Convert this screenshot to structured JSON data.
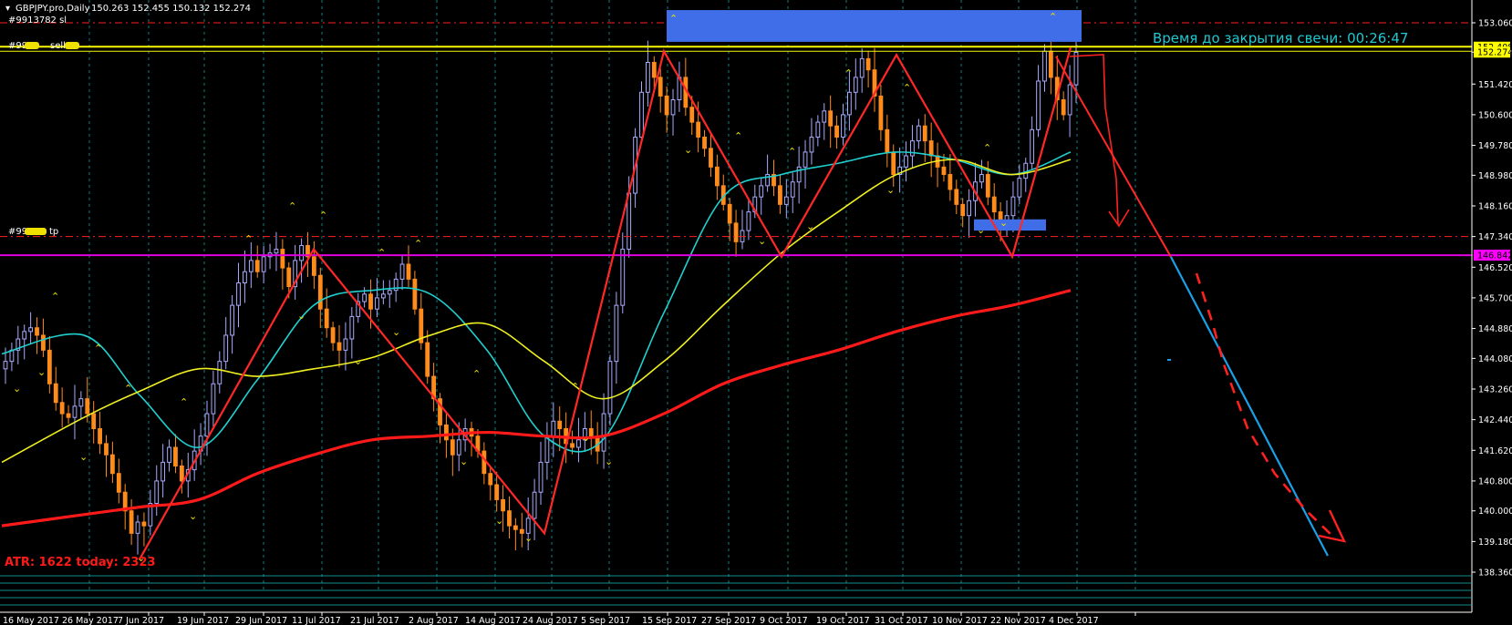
{
  "header": {
    "symbol": "GBPJPY.pro,Daily",
    "ohlc": "150.263 152.455 150.132 152.274",
    "order_sl": "#9913782 sl",
    "order_sell": "#99",
    "order_sell_suffix": "sell",
    "order_tp": "#99",
    "order_tp_suffix": "tp"
  },
  "timer_label": "Время до закрытия свечи: 00:26:47",
  "atr_label": "ATR: 1622  today: 2323",
  "colors": {
    "background": "#000000",
    "bull_candle": "#aaaaff",
    "bear_candle": "#ff8c1a",
    "ma_fast": "#20d0d0",
    "ma_mid": "#f0f020",
    "ma_slow": "#ff1a1a",
    "zigzag": "#ff2828",
    "resistance": "#f8f800",
    "support": "#e000e0",
    "zone": "#3f6ee8",
    "projection": "#1aa0e8",
    "grid": "#1ab0b0"
  },
  "chart_data": {
    "type": "candlestick",
    "title": "GBPJPY.pro,Daily",
    "y_ticks": [
      "153.060",
      "152.274",
      "151.420",
      "150.600",
      "149.780",
      "148.980",
      "148.160",
      "147.340",
      "146.520",
      "145.700",
      "144.880",
      "144.080",
      "143.260",
      "142.440",
      "141.620",
      "140.800",
      "140.000",
      "139.180",
      "138.360"
    ],
    "price_labels": [
      {
        "text": "152.408",
        "value": 152.408,
        "color": "#ffff00"
      },
      {
        "text": "152.274",
        "value": 152.274,
        "color": "#ffff00"
      },
      {
        "text": "146.842",
        "value": 146.842,
        "color": "#ff00ff"
      }
    ],
    "x_ticks": [
      "16 May 2017",
      "26 May 2017",
      "7 Jun 2017",
      "19 Jun 2017",
      "29 Jun 2017",
      "11 Jul 2017",
      "21 Jul 2017",
      "2 Aug 2017",
      "14 Aug 2017",
      "24 Aug 2017",
      "5 Sep 2017",
      "15 Sep 2017",
      "27 Sep 2017",
      "9 Oct 2017",
      "19 Oct 2017",
      "31 Oct 2017",
      "10 Nov 2017",
      "22 Nov 2017",
      "4 Dec 2017"
    ],
    "ylim": [
      138.1,
      153.4
    ],
    "levels": {
      "resistance": 152.42,
      "stop_loss_dashed": 153.06,
      "support": 146.84,
      "take_profit_dashed": 147.34
    },
    "close_series": [
      144.0,
      144.3,
      144.6,
      144.8,
      144.9,
      144.7,
      144.3,
      143.4,
      142.9,
      142.6,
      142.5,
      142.8,
      143.0,
      142.6,
      142.2,
      141.8,
      141.5,
      141.0,
      140.5,
      140.0,
      139.4,
      139.7,
      139.6,
      140.2,
      140.8,
      141.3,
      141.7,
      141.2,
      140.8,
      141.1,
      141.6,
      142.0,
      142.6,
      143.4,
      144.0,
      144.7,
      145.5,
      146.1,
      146.4,
      146.7,
      146.4,
      146.8,
      146.9,
      147.0,
      146.5,
      146.0,
      146.7,
      147.1,
      146.8,
      146.3,
      145.4,
      144.9,
      144.5,
      144.3,
      144.6,
      145.2,
      145.6,
      145.8,
      145.4,
      145.7,
      145.8,
      145.9,
      146.2,
      146.6,
      146.2,
      145.4,
      144.5,
      143.6,
      143.0,
      142.3,
      141.9,
      141.5,
      141.9,
      142.2,
      142.0,
      141.6,
      141.0,
      140.7,
      140.3,
      140.0,
      139.6,
      139.5,
      139.4,
      139.8,
      140.5,
      141.3,
      142.0,
      142.4,
      142.2,
      141.8,
      141.7,
      141.9,
      142.2,
      142.0,
      141.6,
      142.6,
      144.0,
      145.5,
      147.0,
      148.5,
      150.0,
      151.2,
      152.0,
      151.6,
      151.1,
      150.6,
      151.0,
      151.6,
      150.8,
      150.4,
      150.0,
      149.7,
      149.2,
      148.7,
      148.2,
      147.7,
      147.2,
      147.5,
      148.0,
      148.4,
      148.7,
      149.0,
      148.7,
      148.2,
      148.4,
      148.8,
      149.2,
      149.6,
      150.0,
      150.4,
      150.7,
      150.3,
      150.0,
      150.6,
      151.2,
      151.6,
      152.1,
      151.8,
      151.1,
      150.2,
      149.6,
      149.0,
      149.2,
      149.5,
      149.9,
      150.3,
      149.9,
      149.5,
      149.2,
      149.0,
      148.6,
      148.2,
      147.9,
      148.3,
      148.8,
      149.0,
      148.4,
      148.0,
      147.6,
      147.9,
      148.4,
      148.9,
      149.3,
      150.2,
      151.5,
      152.3,
      151.6,
      151.0,
      150.6,
      151.4,
      152.27
    ],
    "ma_fast": [
      {
        "x": "16 May 2017",
        "y": 144.2
      },
      {
        "x": "26 May 2017",
        "y": 144.7
      },
      {
        "x": "7 Jun 2017",
        "y": 143.1
      },
      {
        "x": "19 Jun 2017",
        "y": 141.7
      },
      {
        "x": "29 Jun 2017",
        "y": 143.5
      },
      {
        "x": "11 Jul 2017",
        "y": 145.5
      },
      {
        "x": "21 Jul 2017",
        "y": 145.9
      },
      {
        "x": "2 Aug 2017",
        "y": 145.8
      },
      {
        "x": "14 Aug 2017",
        "y": 144.3
      },
      {
        "x": "24 Aug 2017",
        "y": 142.0
      },
      {
        "x": "5 Sep 2017",
        "y": 141.9
      },
      {
        "x": "15 Sep 2017",
        "y": 145.3
      },
      {
        "x": "27 Sep 2017",
        "y": 148.4
      },
      {
        "x": "9 Oct 2017",
        "y": 149.0
      },
      {
        "x": "19 Oct 2017",
        "y": 149.3
      },
      {
        "x": "31 Oct 2017",
        "y": 149.6
      },
      {
        "x": "10 Nov 2017",
        "y": 149.4
      },
      {
        "x": "22 Nov 2017",
        "y": 149.0
      },
      {
        "x": "4 Dec 2017",
        "y": 149.6
      }
    ],
    "ma_mid": [
      {
        "x": "16 May 2017",
        "y": 141.3
      },
      {
        "x": "26 May 2017",
        "y": 142.5
      },
      {
        "x": "7 Jun 2017",
        "y": 143.2
      },
      {
        "x": "19 Jun 2017",
        "y": 143.8
      },
      {
        "x": "29 Jun 2017",
        "y": 143.6
      },
      {
        "x": "11 Jul 2017",
        "y": 143.8
      },
      {
        "x": "21 Jul 2017",
        "y": 144.1
      },
      {
        "x": "2 Aug 2017",
        "y": 144.7
      },
      {
        "x": "14 Aug 2017",
        "y": 145.0
      },
      {
        "x": "24 Aug 2017",
        "y": 144.0
      },
      {
        "x": "5 Sep 2017",
        "y": 143.0
      },
      {
        "x": "15 Sep 2017",
        "y": 144.0
      },
      {
        "x": "27 Sep 2017",
        "y": 145.5
      },
      {
        "x": "9 Oct 2017",
        "y": 146.9
      },
      {
        "x": "19 Oct 2017",
        "y": 148.0
      },
      {
        "x": "31 Oct 2017",
        "y": 149.0
      },
      {
        "x": "10 Nov 2017",
        "y": 149.4
      },
      {
        "x": "22 Nov 2017",
        "y": 149.0
      },
      {
        "x": "4 Dec 2017",
        "y": 149.4
      }
    ],
    "ma_slow": [
      {
        "x": "16 May 2017",
        "y": 139.6
      },
      {
        "x": "26 May 2017",
        "y": 139.9
      },
      {
        "x": "7 Jun 2017",
        "y": 140.1
      },
      {
        "x": "19 Jun 2017",
        "y": 140.3
      },
      {
        "x": "29 Jun 2017",
        "y": 141.0
      },
      {
        "x": "11 Jul 2017",
        "y": 141.5
      },
      {
        "x": "21 Jul 2017",
        "y": 141.9
      },
      {
        "x": "2 Aug 2017",
        "y": 142.0
      },
      {
        "x": "14 Aug 2017",
        "y": 142.1
      },
      {
        "x": "24 Aug 2017",
        "y": 142.0
      },
      {
        "x": "5 Sep 2017",
        "y": 142.0
      },
      {
        "x": "15 Sep 2017",
        "y": 142.6
      },
      {
        "x": "27 Sep 2017",
        "y": 143.4
      },
      {
        "x": "9 Oct 2017",
        "y": 143.9
      },
      {
        "x": "19 Oct 2017",
        "y": 144.3
      },
      {
        "x": "31 Oct 2017",
        "y": 144.8
      },
      {
        "x": "10 Nov 2017",
        "y": 145.2
      },
      {
        "x": "22 Nov 2017",
        "y": 145.5
      },
      {
        "x": "4 Dec 2017",
        "y": 145.9
      }
    ],
    "zigzag": [
      {
        "x": "7 Jun 2017",
        "y": 138.7
      },
      {
        "x": "11 Jul 2017",
        "y": 147.0
      },
      {
        "x": "24 Aug 2017",
        "y": 139.4
      },
      {
        "x": "15 Sep 2017",
        "y": 152.3
      },
      {
        "x": "9 Oct 2017",
        "y": 146.8
      },
      {
        "x": "31 Oct 2017",
        "y": 152.2
      },
      {
        "x": "22 Nov 2017",
        "y": 146.8
      },
      {
        "x": "4 Dec 2017",
        "y": 152.4
      }
    ],
    "zones": [
      {
        "name": "top-zone",
        "x_from": "15 Sep 2017",
        "x_to": "4 Dec 2017",
        "y_low": 152.55,
        "y_high": 153.4
      },
      {
        "name": "bottom-zone",
        "x_from": "10 Nov 2017",
        "x_to": "22 Nov 2017",
        "y_low": 147.5,
        "y_high": 147.8
      }
    ]
  }
}
